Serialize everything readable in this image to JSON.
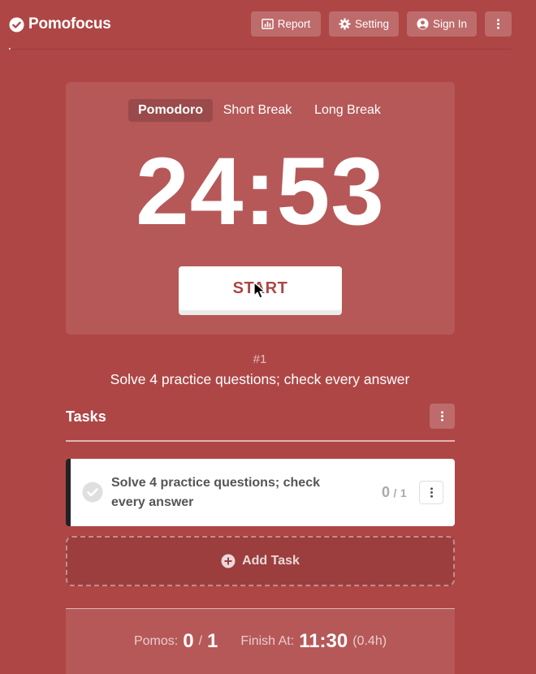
{
  "app": {
    "name": "Pomofocus"
  },
  "header": {
    "report_label": "Report",
    "setting_label": "Setting",
    "signin_label": "Sign In"
  },
  "timer": {
    "modes": [
      {
        "label": "Pomodoro",
        "active": true
      },
      {
        "label": "Short Break",
        "active": false
      },
      {
        "label": "Long Break",
        "active": false
      }
    ],
    "time": "24:53",
    "start_label": "START"
  },
  "current_task": {
    "number": "#1",
    "title": "Solve 4 practice questions; check every answer"
  },
  "tasks": {
    "title": "Tasks",
    "items": [
      {
        "title": "Solve 4 practice questions; check every answer",
        "done": "0",
        "separator": "/",
        "total": "1"
      }
    ],
    "add_label": "Add Task"
  },
  "summary": {
    "pomos_label": "Pomos:",
    "pomos_done": "0",
    "separator": "/",
    "pomos_total": "1",
    "finish_label": "Finish At:",
    "finish_time": "11:30",
    "duration": "(0.4h)"
  },
  "colors": {
    "background": "#ae4646",
    "accent_text": "#ae4646",
    "task_border": "#222222"
  }
}
